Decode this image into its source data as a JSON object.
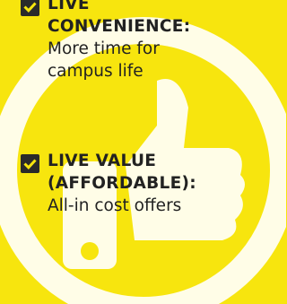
{
  "colors": {
    "background": "#f7e50e",
    "text": "#222222",
    "graphic": "#ffffff",
    "checkbox": "#2a2a2a"
  },
  "background_graphic": "thumbs-up-in-circle-icon",
  "items": [
    {
      "icon": "checkbox-checked-icon",
      "heading_lines": [
        "LIVE",
        "CONVENIENCE:"
      ],
      "body_lines": [
        "More time for",
        "campus life"
      ]
    },
    {
      "icon": "checkbox-checked-icon",
      "heading_lines": [
        "LIVE VALUE",
        "(AFFORDABLE):"
      ],
      "body_lines": [
        "All-in cost offers"
      ]
    }
  ]
}
